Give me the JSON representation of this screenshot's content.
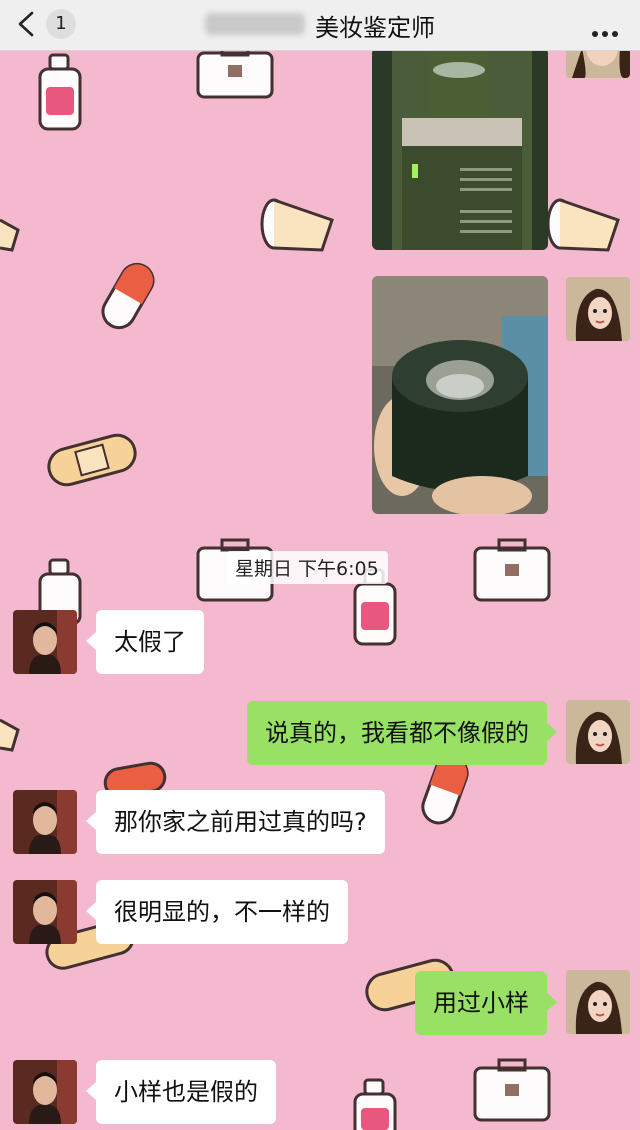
{
  "header": {
    "unread_count": "1",
    "title": "美妆鉴定师"
  },
  "colors": {
    "background": "#f4b8cf",
    "my_bubble": "#98e165",
    "their_bubble": "#ffffff"
  },
  "timestamp": "星期日 下午6:05",
  "messages": [
    {
      "side": "left",
      "text": "太假了"
    },
    {
      "side": "right",
      "text": "说真的，我看都不像假的"
    },
    {
      "side": "left",
      "text": "那你家之前用过真的吗?"
    },
    {
      "side": "left",
      "text": "很明显的，不一样的"
    },
    {
      "side": "right",
      "text": "用过小样"
    },
    {
      "side": "left",
      "text": "小样也是假的"
    }
  ]
}
